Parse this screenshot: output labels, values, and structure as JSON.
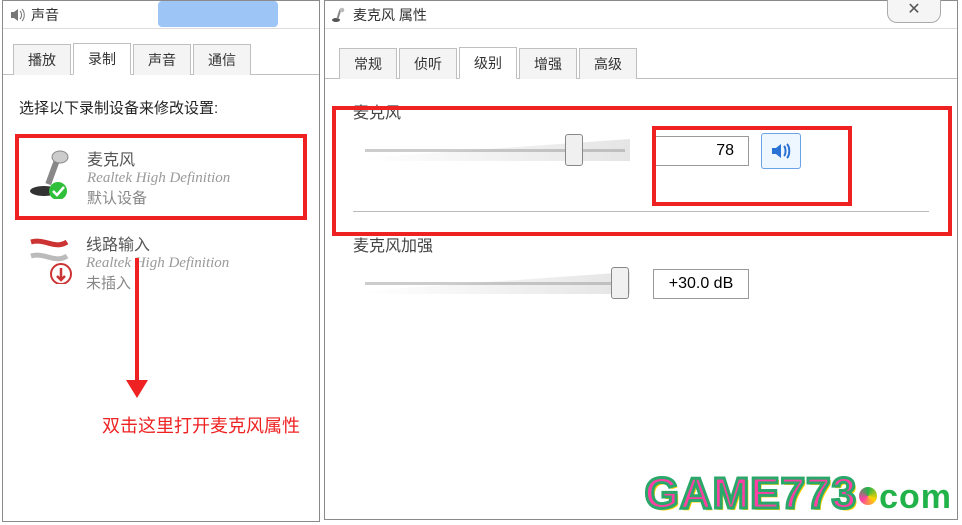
{
  "sound_window": {
    "title": "声音",
    "tabs": [
      "播放",
      "录制",
      "声音",
      "通信"
    ],
    "active_tab_index": 1,
    "instruction": "选择以下录制设备来修改设置:",
    "devices": [
      {
        "name": "麦克风",
        "driver": "Realtek High Definition",
        "status": "默认设备"
      },
      {
        "name": "线路输入",
        "driver": "Realtek High Definition",
        "status": "未插入"
      }
    ],
    "annotation": "双击这里打开麦克风属性"
  },
  "props_window": {
    "title": "麦克风 属性",
    "tabs": [
      "常规",
      "侦听",
      "级别",
      "增强",
      "高级"
    ],
    "active_tab_index": 2,
    "mic": {
      "label": "麦克风",
      "value": "78"
    },
    "boost": {
      "label": "麦克风加强",
      "value": "+30.0 dB"
    }
  },
  "watermark": {
    "brand": "GAME773",
    "suffix": "com"
  }
}
